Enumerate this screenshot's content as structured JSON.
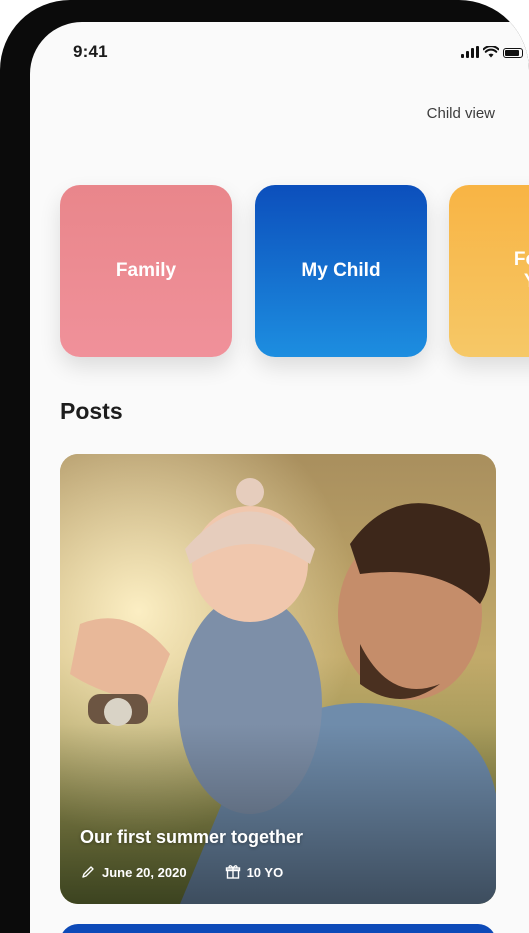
{
  "status_bar": {
    "time": "9:41"
  },
  "header": {
    "child_view_label": "Child view"
  },
  "categories": [
    {
      "label": "Family",
      "color": "#ee8d95"
    },
    {
      "label": "My Child",
      "color": "#1366cc"
    },
    {
      "label": "Forn\nYe",
      "color": "#f7bb4f"
    }
  ],
  "posts": {
    "title": "Posts",
    "items": [
      {
        "title": "Our first summer together",
        "date": "June 20, 2020",
        "age": "10 YO"
      }
    ]
  },
  "icons": {
    "date": "pencil-icon",
    "age": "gift-icon"
  }
}
